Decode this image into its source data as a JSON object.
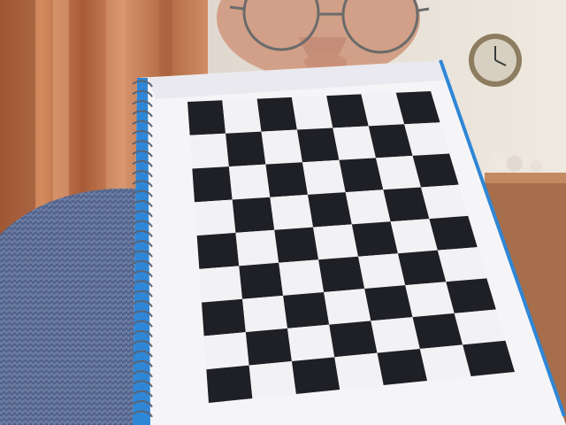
{
  "scene": {
    "description_labels": [],
    "objects": {
      "curtain": "curtain",
      "wall": "wall",
      "wall_clock": "wall-clock",
      "shelf": "shelf",
      "person": "person",
      "glasses": "glasses",
      "sweater": "sweater",
      "notebook": "spiral-notebook",
      "checkerboard": "checkerboard-pattern"
    },
    "checkerboard": {
      "rows": 9,
      "cols": 7,
      "dark_color": "#1f1f26",
      "light_color": "#f2f2f4"
    },
    "colors": {
      "curtain": "#c77a4c",
      "curtain_dark": "#9c5431",
      "wall": "#d8d1c6",
      "shelf": "#a86b47",
      "sweater": "#5a6f95",
      "skin": "#d2a088",
      "spiral_blue": "#2f86d6"
    }
  }
}
